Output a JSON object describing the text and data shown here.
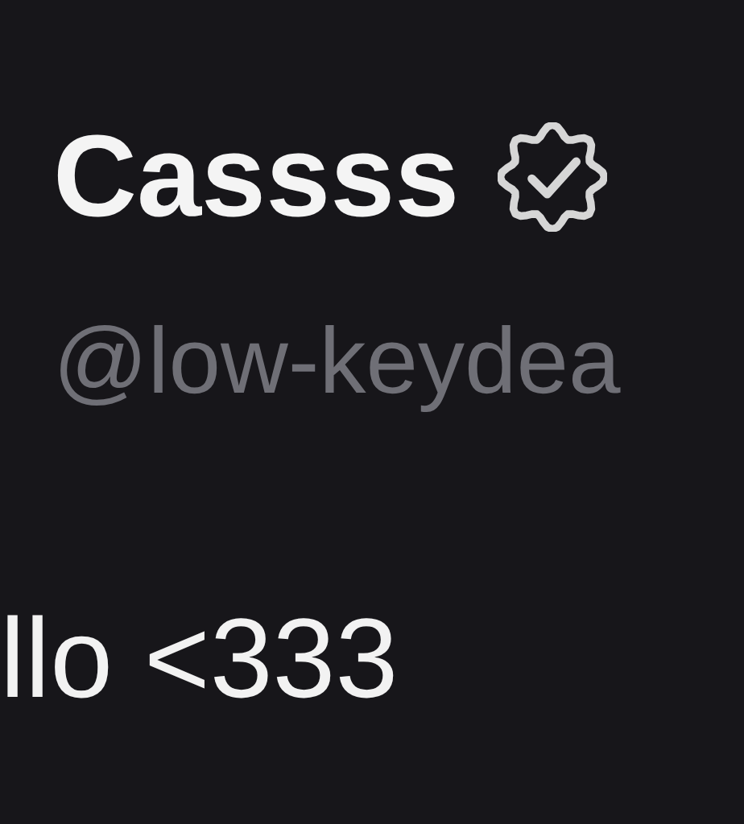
{
  "profile": {
    "name": "Cassss",
    "verified": true,
    "handle": "@low-keydea"
  },
  "message": {
    "text": "llo <333"
  }
}
